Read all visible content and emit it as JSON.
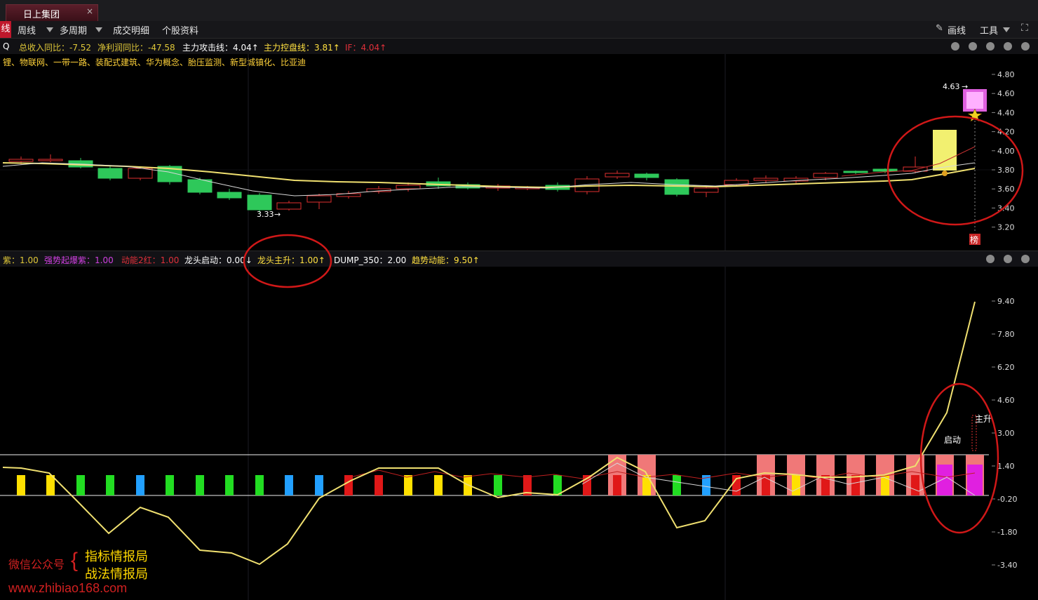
{
  "window": {
    "tab_title": "日上集团",
    "close_symbol": "×"
  },
  "toolbar": {
    "left_label": "线",
    "items": [
      "周线",
      "多周期",
      "成交明细",
      "个股资料"
    ],
    "draw": "画线",
    "tools": "工具"
  },
  "top_info": {
    "prefix": "Q",
    "items": [
      {
        "text": "总收入同比：-7.52",
        "color": "#e0c838"
      },
      {
        "text": "净利润同比：-47.58",
        "color": "#e0c838"
      },
      {
        "text": "主力攻击线：4.04↑",
        "color": "#ffffff"
      },
      {
        "text": "主力控盘线：3.81↑",
        "color": "#ffe040"
      },
      {
        "text": "IF：4.04↑",
        "color": "#e0303a"
      }
    ]
  },
  "concepts": "锂、物联网、一带一路、装配式建筑、华为概念、胎压监测、新型城镇化、比亚迪",
  "price_chart": {
    "y_ticks": [
      "4.80",
      "4.60",
      "4.40",
      "4.20",
      "4.00",
      "3.80",
      "3.60",
      "3.40",
      "3.20"
    ],
    "high_label": "4.63",
    "low_label": "3.33",
    "badge": "榜"
  },
  "lower_info": {
    "items": [
      {
        "text": "紫：1.00",
        "color": "#e0c838"
      },
      {
        "text": "强势起爆紫：1.00",
        "color": "#d040e0"
      },
      {
        "text": "动能2红：1.00",
        "color": "#e0303a"
      },
      {
        "text": "龙头启动：0.00↓",
        "color": "#ffffff"
      },
      {
        "text": "龙头主升：1.00↑",
        "color": "#ffe040"
      },
      {
        "text": "DUMP_350：2.00",
        "color": "#ffffff"
      },
      {
        "text": "趋势动能：9.50↑",
        "color": "#ffe040"
      }
    ]
  },
  "indicator_chart": {
    "y_ticks": [
      "9.40",
      "7.80",
      "6.20",
      "4.60",
      "3.00",
      "1.40",
      "-0.20",
      "-1.80",
      "-3.40"
    ],
    "start_label": "启动",
    "rise_label": "主升"
  },
  "watermark": {
    "account_label": "微信公众号",
    "brace": "{",
    "name1": "指标情报局",
    "name2": "战法情报局",
    "url": "www.zhibiao168.com"
  },
  "colors": {
    "up": "#e03030",
    "down": "#2ec85a",
    "ma": "#f0e070",
    "annotation": "#d01818"
  }
}
